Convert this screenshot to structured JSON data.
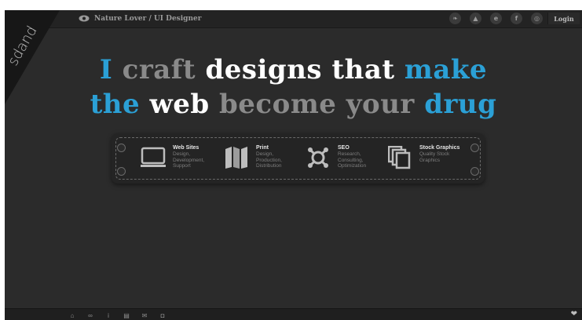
{
  "header": {
    "tagline": "Nature Lover / UI Designer",
    "login_label": "Login",
    "social_icons": [
      "twitter-icon",
      "deviantart-icon",
      "behance-icon",
      "facebook-icon",
      "dribbble-icon"
    ],
    "social_glyphs": [
      "❧",
      "▲",
      "e",
      "f",
      "◎"
    ]
  },
  "logo": {
    "text": "sdand"
  },
  "hero": {
    "line1": [
      {
        "text": "I",
        "tone": "blue"
      },
      {
        "text": "craft",
        "tone": "grey"
      },
      {
        "text": "designs that",
        "tone": "white"
      },
      {
        "text": "make",
        "tone": "blue"
      }
    ],
    "line2": [
      {
        "text": "the",
        "tone": "blue"
      },
      {
        "text": "web",
        "tone": "white"
      },
      {
        "text": "become",
        "tone": "grey"
      },
      {
        "text": "your",
        "tone": "grey"
      },
      {
        "text": "drug",
        "tone": "blue"
      }
    ]
  },
  "services": [
    {
      "title": "Web Sites",
      "desc": "Design,\nDevelopment,\nSupport",
      "icon": "monitor-icon"
    },
    {
      "title": "Print",
      "desc": "Design,\nProduction,\nDistribution",
      "icon": "map-icon"
    },
    {
      "title": "SEO",
      "desc": "Research,\nConsulting,\nOptimization",
      "icon": "network-icon"
    },
    {
      "title": "Stock Graphics",
      "desc": "Quality Stock\nGraphics",
      "icon": "stack-icon"
    }
  ],
  "footer": {
    "icons": [
      "home-icon",
      "link-icon",
      "info-icon",
      "document-icon",
      "mail-icon",
      "gamepad-icon"
    ],
    "glyphs": [
      "⌂",
      "∞",
      "i",
      "▤",
      "✉",
      "◘"
    ]
  },
  "colors": {
    "accent": "#2ba0d6",
    "grey": "#8a8a8a",
    "white": "#ffffff",
    "background": "#2b2b2b"
  }
}
